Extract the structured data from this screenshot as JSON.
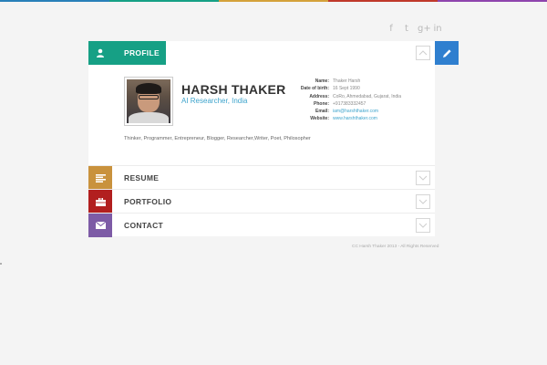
{
  "topbar_colors": [
    "#2980b9",
    "#16a085",
    "#d4a13a",
    "#c0392b",
    "#8e44ad"
  ],
  "social": {
    "facebook": "f",
    "twitter": "t",
    "googleplus": "g+",
    "linkedin": "in"
  },
  "profile_tab": {
    "label": "PROFILE",
    "color": "#16a085"
  },
  "profile": {
    "name": "HARSH THAKER",
    "subtitle": "AI Researcher, India",
    "info": [
      {
        "key": "Name:",
        "value": "Thaker Harsh"
      },
      {
        "key": "Date of birth:",
        "value": "16 Sept 1990"
      },
      {
        "key": "Address:",
        "value": "CoRo, Ahmedabad, Gujarat, India"
      },
      {
        "key": "Phone:",
        "value": "+917383332457"
      },
      {
        "key": "Email:",
        "value": "iam@harshthaker.com"
      },
      {
        "key": "Website:",
        "value": "www.harshthaker.com"
      }
    ],
    "bio": "Thinker, Programmer, Entrepreneur, Blogger, Researcher,Writer, Poet, Philosopher"
  },
  "sections": [
    {
      "label": "RESUME",
      "color": "#c9923d",
      "icon": "list-icon"
    },
    {
      "label": "PORTFOLIO",
      "color": "#b21f1f",
      "icon": "briefcase-icon"
    },
    {
      "label": "CONTACT",
      "color": "#7d5ba6",
      "icon": "envelope-icon"
    }
  ],
  "edit_color": "#2f7fcf",
  "footer": "CC Harsh Thaker 2013 - All Rights Reserved"
}
